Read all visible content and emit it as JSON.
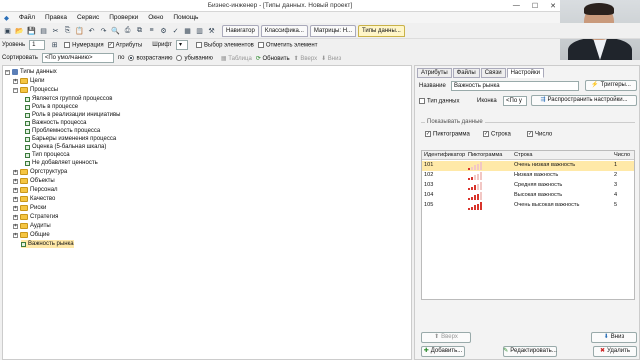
{
  "window": {
    "title": "Бизнес-инженер - [Типы данных. Новый проект]"
  },
  "menu": [
    "Файл",
    "Правка",
    "Сервис",
    "Проверки",
    "Окно",
    "Помощь"
  ],
  "tabs": [
    {
      "label": "Навигатор"
    },
    {
      "label": "Классифика..."
    },
    {
      "label": "Матрицы: Н..."
    },
    {
      "label": "Типы данны..."
    }
  ],
  "options": {
    "level_label": "Уровень",
    "level_value": "1",
    "numbering": "Нумерация",
    "attributes": "Атрибуты",
    "font": "Шрифт",
    "select_elements": "Выбор элементов",
    "mark_element": "Отметить элемент",
    "sort_label": "Сортировать",
    "sort_value": "<По умолчанию>",
    "by": "по",
    "ascending": "возрастанию",
    "descending": "убыванию",
    "table": "Таблица",
    "refresh": "Обновить",
    "up": "Вверх",
    "down": "Вниз"
  },
  "tree": {
    "root": "Типы данных",
    "items": [
      "Цели",
      "Процессы",
      "Является группой процессов",
      "Роль в процессе",
      "Роль в реализации инициативы",
      "Важность процесса",
      "Проблемность процесса",
      "Барьеры изменения процесса",
      "Оценка (5-бальная шкала)",
      "Тип процесса",
      "Не добавляет ценность",
      "Оргструктура",
      "Объекты",
      "Персонал",
      "Качество",
      "Риски",
      "Стратегия",
      "Аудиты",
      "Общие",
      "Важность рынка"
    ]
  },
  "panel": {
    "tabs": [
      "Атрибуты",
      "Файлы",
      "Связи",
      "Настройки"
    ],
    "name_label": "Название",
    "name_value": "Важность рынка",
    "triggers": "Триггеры...",
    "data_type": "Тип данных",
    "icon_label": "Иконка",
    "icon_value": "<По у",
    "spread_settings": "Распространить настройки...",
    "show_data": "Показывать данные",
    "pictogram_cb": "Пиктограмма",
    "string_cb": "Строка",
    "number_cb": "Число",
    "columns": [
      "Идентификатор",
      "Пиктограмма",
      "Строка",
      "Число"
    ],
    "rows": [
      {
        "id": "101",
        "string": "Очень низкая важность",
        "number": "1",
        "bars": 1
      },
      {
        "id": "102",
        "string": "Низкая важность",
        "number": "2",
        "bars": 2
      },
      {
        "id": "103",
        "string": "Средняя важность",
        "number": "3",
        "bars": 3
      },
      {
        "id": "104",
        "string": "Высокая важность",
        "number": "4",
        "bars": 4
      },
      {
        "id": "105",
        "string": "Очень высокая важность",
        "number": "5",
        "bars": 5
      }
    ],
    "up": "Вверх",
    "down": "Вниз",
    "add": "Добавить...",
    "edit": "Редактировать...",
    "delete": "Удалить"
  },
  "colors": {
    "selected": "#ffe9a8",
    "pictogram": "#d9342b",
    "folder": "#f5c542"
  }
}
